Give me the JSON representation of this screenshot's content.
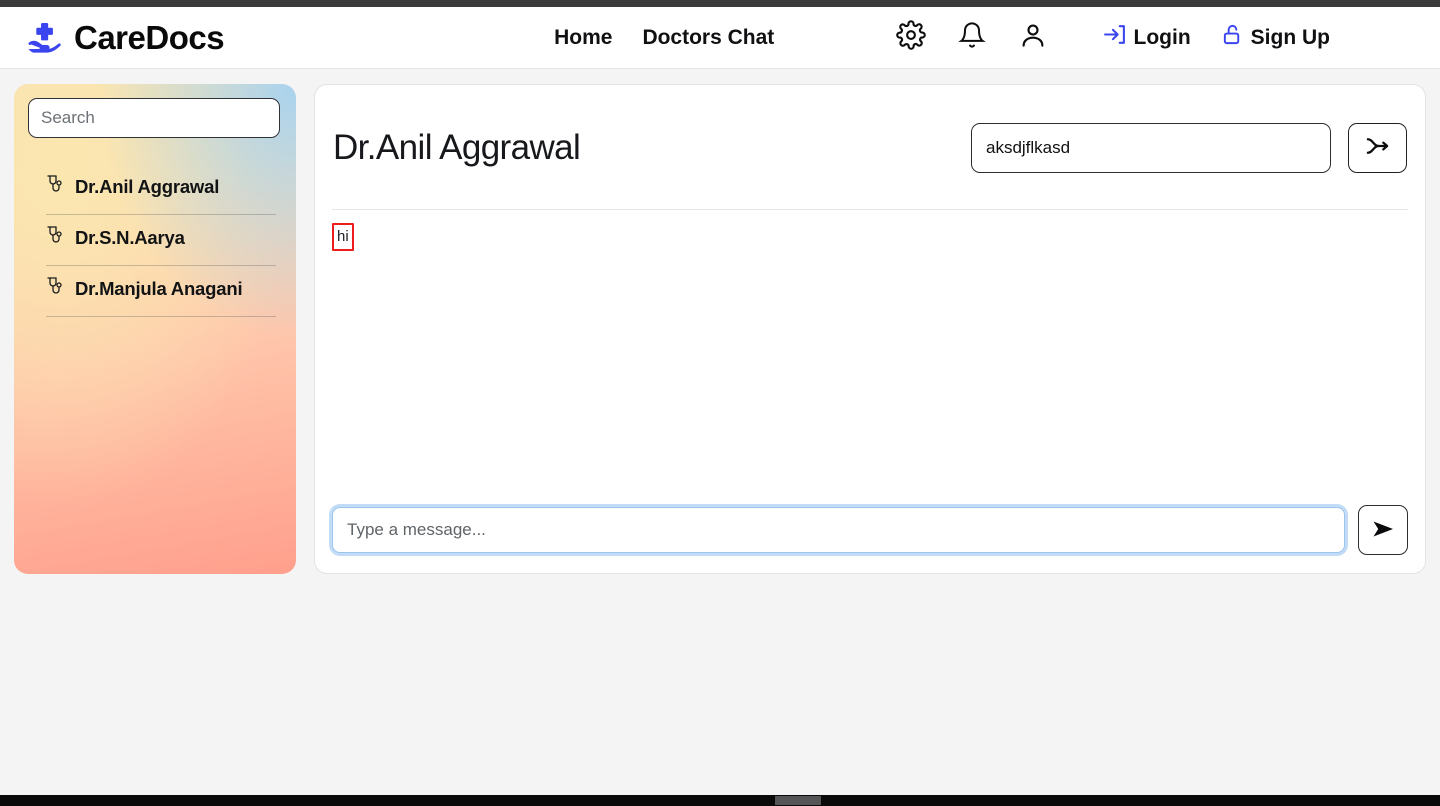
{
  "header": {
    "brand": {
      "name": "CareDocs",
      "icon": "hand-holding-medical-cross-icon",
      "color": "#3a45ef"
    },
    "nav_links": [
      {
        "label": "Home",
        "name": "nav-link-home"
      },
      {
        "label": "Doctors Chat",
        "name": "nav-link-doctors-chat"
      }
    ],
    "icons": [
      {
        "name": "gear-icon",
        "title": "Settings"
      },
      {
        "name": "bell-icon",
        "title": "Notifications"
      },
      {
        "name": "user-icon",
        "title": "Account"
      }
    ],
    "auth": [
      {
        "label": "Login",
        "icon": "login-arrow-icon",
        "color": "#3a45ef"
      },
      {
        "label": "Sign Up",
        "icon": "unlock-padlock-icon",
        "color": "#3a45ef"
      }
    ]
  },
  "sidebar": {
    "search": {
      "value": "",
      "placeholder": "Search"
    },
    "doctors": [
      {
        "name": "Dr.Anil Aggrawal",
        "icon": "stethoscope-icon"
      },
      {
        "name": "Dr.S.N.Aarya",
        "icon": "stethoscope-icon"
      },
      {
        "name": "Dr.Manjula Anagani",
        "icon": "stethoscope-icon"
      }
    ]
  },
  "chat": {
    "title": "Dr.Anil Aggrawal",
    "header_input": {
      "value": "aksdjflkasd",
      "placeholder": ""
    },
    "header_button": {
      "icon": "merge-arrow-icon",
      "label": ""
    },
    "messages": [
      {
        "text": "hi",
        "border_color": "#ef1c1c",
        "side": "left"
      }
    ],
    "composer": {
      "value": "",
      "placeholder": "Type a message...",
      "send_button": {
        "icon": "send-arrow-icon",
        "label": ""
      }
    }
  },
  "browser": {
    "top_bar_color": "#3b3b3b",
    "scrollbar_color": "#0a0a0a",
    "scrollbar_thumb_color": "#555557"
  }
}
